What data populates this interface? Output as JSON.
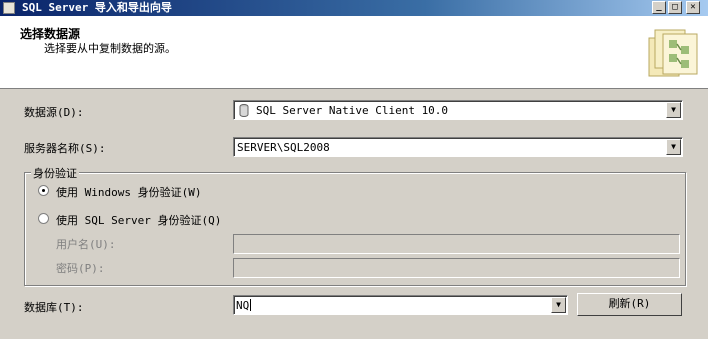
{
  "window": {
    "title": "SQL Server 导入和导出向导"
  },
  "titlebar_buttons": [
    {
      "name": "minimize",
      "glyph": "_"
    },
    {
      "name": "maximize",
      "glyph": "□"
    },
    {
      "name": "close",
      "glyph": "✕"
    }
  ],
  "header": {
    "title": "选择数据源",
    "subtitle": "选择要从中复制数据的源。"
  },
  "source": {
    "label": "数据源(D):",
    "value": "SQL Server Native Client 10.0"
  },
  "server": {
    "label": "服务器名称(S):",
    "value": "SERVER\\SQL2008"
  },
  "auth": {
    "group_label": "身份验证",
    "windows_label": "使用 Windows 身份验证(W)",
    "sql_label": "使用 SQL Server 身份验证(Q)",
    "selected": "windows",
    "username_label": "用户名(U):",
    "password_label": "密码(P):",
    "username_value": "",
    "password_value": ""
  },
  "database": {
    "label": "数据库(T):",
    "value": "NQ",
    "refresh_label": "刷新(R)"
  },
  "icons": {
    "app": "sql-server-app-icon",
    "wizard": "wizard-transfer-icon",
    "datasource": "database-icon"
  }
}
